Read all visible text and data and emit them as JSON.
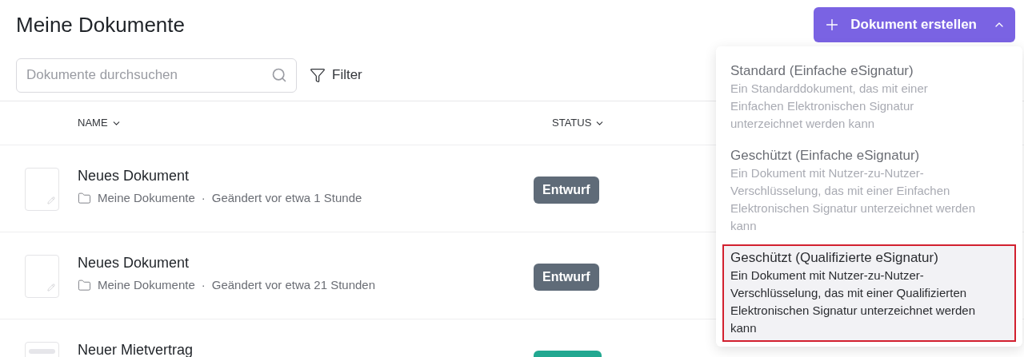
{
  "page_title": "Meine Dokumente",
  "create_button": {
    "label": "Dokument erstellen",
    "expanded": true
  },
  "search": {
    "placeholder": "Dokumente durchsuchen"
  },
  "filter": {
    "label": "Filter"
  },
  "table": {
    "columns": [
      "NAME",
      "STATUS"
    ],
    "rows": [
      {
        "title": "Neues Dokument",
        "folder": "Meine Dokumente",
        "separator": "·",
        "modified": "Geändert vor etwa 1 Stunde",
        "status": "Entwurf",
        "color": "#5f6b78",
        "kind": "blank"
      },
      {
        "title": "Neues Dokument",
        "folder": "Meine Dokumente",
        "separator": "·",
        "modified": "Geändert vor etwa 21 Stunden",
        "status": "Entwurf",
        "color": "#5f6b78",
        "kind": "blank"
      },
      {
        "title": "Neuer Mietvertrag",
        "color": "#22a891",
        "kind": "filled"
      }
    ]
  },
  "menu": {
    "items": [
      {
        "title": "Standard (Einfache eSignatur)",
        "description": "Ein Standarddokument, das mit einer Einfachen Elektronischen Signatur unterzeichnet werden kann",
        "selected": false
      },
      {
        "title": "Geschützt (Einfache eSignatur)",
        "description": "Ein Dokument mit Nutzer-zu-Nutzer-Verschlüsselung, das mit einer Einfachen Elektronischen Signatur unterzeichnet werden kann",
        "selected": false
      },
      {
        "title": "Geschützt (Qualifizierte eSignatur)",
        "description": "Ein Dokument mit Nutzer-zu-Nutzer-Verschlüsselung, das mit einer Qualifizierten Elektronischen Signatur unterzeichnet werden kann",
        "selected": true
      }
    ]
  }
}
